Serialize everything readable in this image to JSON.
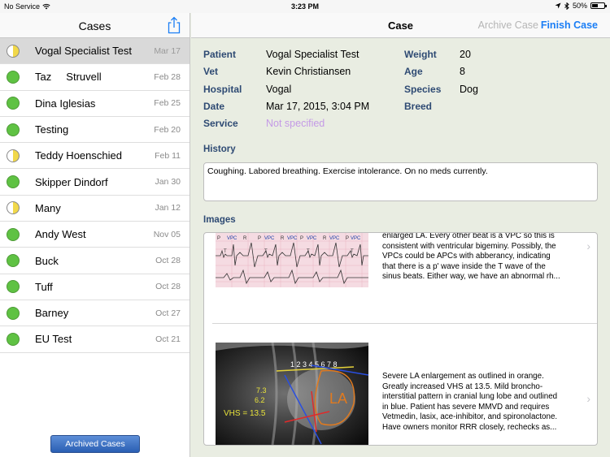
{
  "status_bar": {
    "carrier": "No Service",
    "time": "3:23 PM",
    "battery": "50%"
  },
  "sidebar": {
    "title": "Cases",
    "archived_button": "Archived Cases",
    "cases": [
      {
        "name": "Vogal Specialist Test",
        "date": "Mar 17",
        "status": "half",
        "selected": true
      },
      {
        "name": "Taz     Struvell",
        "date": "Feb 28",
        "status": "green"
      },
      {
        "name": "Dina Iglesias",
        "date": "Feb 25",
        "status": "green"
      },
      {
        "name": "Testing",
        "date": "Feb 20",
        "status": "green"
      },
      {
        "name": "Teddy Hoenschied",
        "date": "Feb 11",
        "status": "half"
      },
      {
        "name": "Skipper Dindorf",
        "date": "Jan 30",
        "status": "green"
      },
      {
        "name": "Many",
        "date": "Jan 12",
        "status": "half"
      },
      {
        "name": "Andy West",
        "date": "Nov 05",
        "status": "green"
      },
      {
        "name": "Buck",
        "date": "Oct 28",
        "status": "green"
      },
      {
        "name": "Tuff",
        "date": "Oct 28",
        "status": "green"
      },
      {
        "name": "Barney",
        "date": "Oct 27",
        "status": "green"
      },
      {
        "name": "EU Test",
        "date": "Oct 21",
        "status": "green"
      }
    ]
  },
  "main": {
    "title": "Case",
    "archive_button": "Archive Case",
    "finish_button": "Finish Case",
    "fields": {
      "patient_label": "Patient",
      "patient_value": "Vogal Specialist Test",
      "vet_label": "Vet",
      "vet_value": "Kevin Christiansen",
      "hospital_label": "Hospital",
      "hospital_value": "Vogal",
      "date_label": "Date",
      "date_value": "Mar 17, 2015, 3:04 PM",
      "service_label": "Service",
      "service_value": "Not specified",
      "weight_label": "Weight",
      "weight_value": "20",
      "age_label": "Age",
      "age_value": "8",
      "species_label": "Species",
      "species_value": "Dog",
      "breed_label": "Breed",
      "breed_value": ""
    },
    "history_label": "History",
    "history_text": "Coughing. Labored breathing. Exercise intolerance. On no meds currently.",
    "images_label": "Images",
    "images": [
      {
        "lines": [
          "enlarged LA. Every other beat is a VPC so this is",
          "consistent with ventricular bigeminy. Possibly, the",
          "VPCs could be APCs with abberancy, indicating",
          "that there is a p' wave inside the T wave of the",
          "sinus beats. Either way, we have an abnormal rh..."
        ]
      },
      {
        "lines": [
          "Severe LA enlargement as outlined in orange.",
          "Greatly increased VHS at 13.5. Mild broncho-",
          "interstitial pattern in cranial lung lobe and outlined",
          "in blue. Patient has severe MMVD and requires",
          "Vetmedin, lasix, ace-inhibitor, and spironolactone.",
          "Have owners monitor RRR closely, rechecks as..."
        ]
      }
    ],
    "ecg_labels": {
      "vpc": "VPC",
      "p": "P",
      "r": "R",
      "t": "T"
    },
    "xray_labels": {
      "vhs": "VHS = 13.5",
      "la": "LA",
      "n1": "7.3",
      "n2": "6.2",
      "digits": "1 2 3 4 5 6 7 8"
    }
  },
  "colors": {
    "accent": "#1a7ef5",
    "label": "#2e4a73",
    "muted": "#c49ae6",
    "green": "#5fc243",
    "yellow": "#f1d84a"
  }
}
